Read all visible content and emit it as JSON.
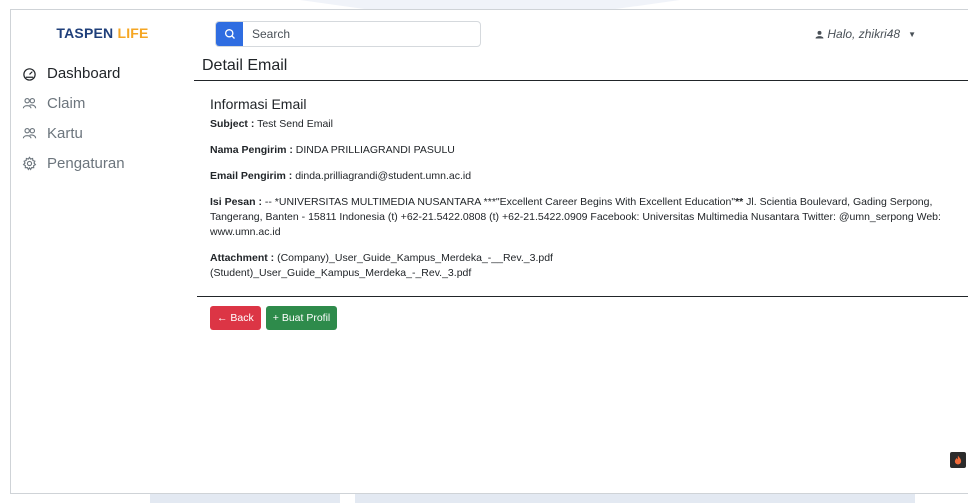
{
  "brand": {
    "part1": "TASPEN",
    "part2": "LIFE"
  },
  "sidebar": {
    "items": [
      {
        "label": "Dashboard",
        "icon": "dashboard-icon"
      },
      {
        "label": "Claim",
        "icon": "users-icon"
      },
      {
        "label": "Kartu",
        "icon": "users-icon"
      },
      {
        "label": "Pengaturan",
        "icon": "gear-icon"
      }
    ]
  },
  "topbar": {
    "search_placeholder": "Search",
    "user_greeting": "Halo, zhikri48"
  },
  "main": {
    "title": "Detail Email",
    "section_title": "Informasi Email",
    "subject_label": "Subject :",
    "subject_value": "Test Send Email",
    "sender_name_label": "Nama Pengirim :",
    "sender_name_value": "DINDA PRILLIAGRANDI PASULU",
    "sender_email_label": "Email Pengirim :",
    "sender_email_value": "dinda.prilliagrandi@student.umn.ac.id",
    "message_label": "Isi Pesan :",
    "message_pre": "-- *UNIVERSITAS MULTIMEDIA NUSANTARA ***\"Excellent Career Begins With Excellent Education\"",
    "message_bold": "**",
    "message_post": " Jl. Scientia Boulevard, Gading Serpong, Tangerang, Banten - 15811 Indonesia (t) +62-21.5422.0808  (t)  +62-21.5422.0909  Facebook: Universitas Multimedia Nusantara Twitter: @umn_serpong Web: www.umn.ac.id",
    "attachment_label": "Attachment :",
    "attachment_1": "(Company)_User_Guide_Kampus_Merdeka_-__Rev._3.pdf",
    "attachment_2": "(Student)_User_Guide_Kampus_Merdeka_-_Rev._3.pdf",
    "back_label": "← Back",
    "profil_label": "+ Buat Profil"
  },
  "colors": {
    "primary": "#2f6de1",
    "danger": "#dc3545",
    "success": "#2e8b4b",
    "brand_blue": "#1f3f7a",
    "brand_orange": "#f5a623"
  }
}
